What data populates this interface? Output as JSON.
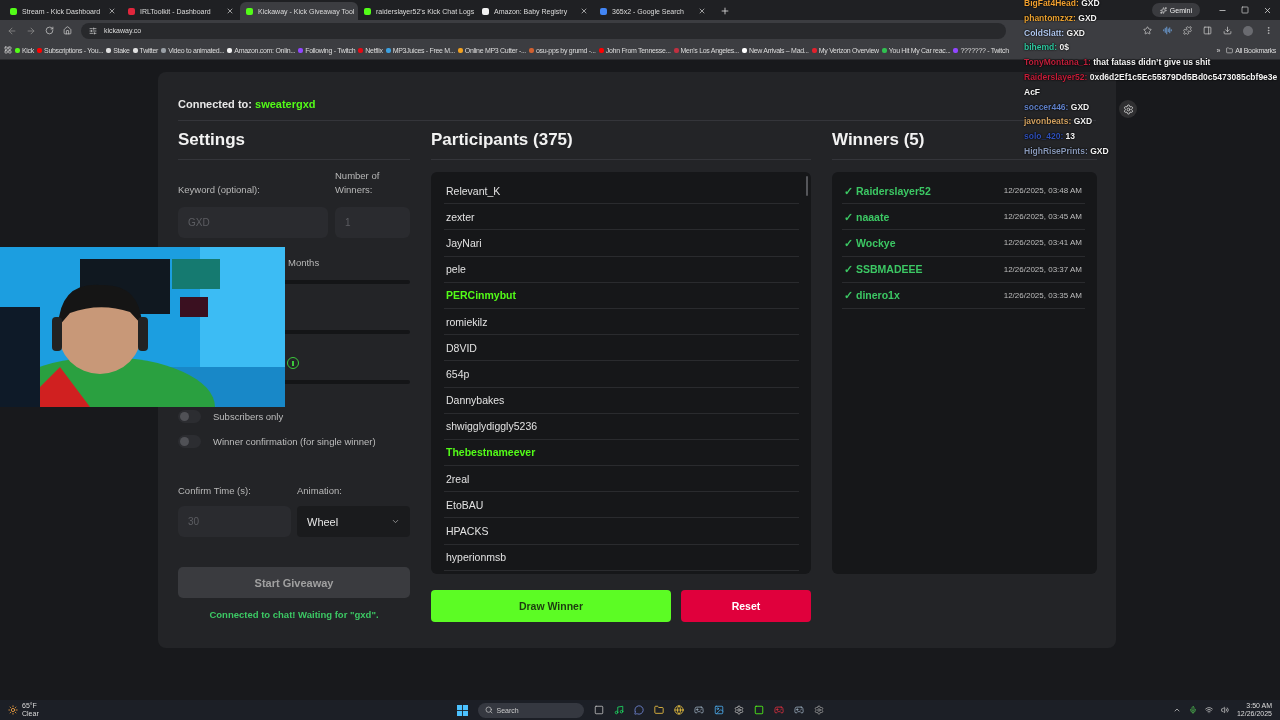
{
  "browser": {
    "tabs": [
      {
        "title": "Stream - Kick Dashboard",
        "selected": false,
        "color": "#53fc18"
      },
      {
        "title": "IRLToolkit - Dashboard",
        "selected": false,
        "color": "#e0263c"
      },
      {
        "title": "Kickaway - Kick Giveaway Tool",
        "selected": true,
        "color": "#53fc18"
      },
      {
        "title": "raiderslayer52's Kick Chat Logs",
        "selected": false,
        "color": "#53fc18"
      },
      {
        "title": "Amazon: Baby Registry",
        "selected": false,
        "color": "#f2f2f2"
      },
      {
        "title": "365x2 - Google Search",
        "selected": false,
        "color": "#4285f4"
      }
    ],
    "gemini": "Gemini",
    "url": "kickaway.co",
    "bookmarks": [
      {
        "label": "Kick",
        "color": "#53fc18"
      },
      {
        "label": "Subscriptions - You...",
        "color": "#ff0000"
      },
      {
        "label": "Stake",
        "color": "#e0e0e0"
      },
      {
        "label": "Twitter",
        "color": "#e0e0e0"
      },
      {
        "label": "Video to animated...",
        "color": "#9aa0a6"
      },
      {
        "label": "Amazon.com: Onlin...",
        "color": "#f2f2f2"
      },
      {
        "label": "Following - Twitch",
        "color": "#9146ff"
      },
      {
        "label": "Netflix",
        "color": "#e50914"
      },
      {
        "label": "MP3Juices - Free M...",
        "color": "#3ca0e0"
      },
      {
        "label": "Online MP3 Cutter -...",
        "color": "#f0a020"
      },
      {
        "label": "osu-pps by grumd -...",
        "color": "#d06030"
      },
      {
        "label": "John From Tennesse...",
        "color": "#ff0000"
      },
      {
        "label": "Men's Los Angeles...",
        "color": "#c03040"
      },
      {
        "label": "New Arrivals – Mad...",
        "color": "#ffffff"
      },
      {
        "label": "My Verizon Overview",
        "color": "#e0202c"
      },
      {
        "label": "You Hit My Car reac...",
        "color": "#30c050"
      },
      {
        "label": "??????? - Twitch",
        "color": "#9146ff"
      }
    ],
    "more": "»",
    "all_bookmarks": "All Bookmarks"
  },
  "page": {
    "connection": {
      "label": "Connected to:",
      "channel": "sweatergxd"
    },
    "settings": {
      "title": "Settings",
      "keyword": {
        "label": "Keyword (optional):",
        "placeholder": "GXD"
      },
      "winner_count": {
        "label": "Number of Winners:",
        "placeholder": "1"
      },
      "months_label": "Months",
      "toggles": [
        {
          "label": "Subscribers only",
          "on": false
        },
        {
          "label": "Winner confirmation (for single winner)",
          "on": false
        }
      ],
      "confirm_time": {
        "label": "Confirm Time (s):",
        "placeholder": "30"
      },
      "animation": {
        "label": "Animation:",
        "value": "Wheel"
      },
      "start_button": {
        "label": "Start Giveaway",
        "disabled": true
      },
      "status": "Connected to chat! Waiting for \"gxd\"."
    },
    "participants": {
      "title": "Participants (375)",
      "items": [
        {
          "name": "Relevant_K",
          "highlighted": false
        },
        {
          "name": "zexter",
          "highlighted": false
        },
        {
          "name": "JayNari",
          "highlighted": false
        },
        {
          "name": "pele",
          "highlighted": false
        },
        {
          "name": "PERCinmybut",
          "highlighted": true
        },
        {
          "name": "romiekilz",
          "highlighted": false
        },
        {
          "name": "D8VID",
          "highlighted": false
        },
        {
          "name": "654p",
          "highlighted": false
        },
        {
          "name": "Dannybakes",
          "highlighted": false
        },
        {
          "name": "shwigglydiggly5236",
          "highlighted": false
        },
        {
          "name": "Thebestnameever",
          "highlighted": true
        },
        {
          "name": "2real",
          "highlighted": false
        },
        {
          "name": "EtoBAU",
          "highlighted": false
        },
        {
          "name": "HPACKS",
          "highlighted": false
        },
        {
          "name": "hyperionmsb",
          "highlighted": false
        }
      ],
      "draw_button": "Draw Winner",
      "reset_button": "Reset"
    },
    "winners": {
      "title": "Winners (5)",
      "items": [
        {
          "mark": "✓",
          "name": "Raiderslayer52",
          "time": "12/26/2025, 03:48 AM"
        },
        {
          "mark": "✓",
          "name": "naaate",
          "time": "12/26/2025, 03:45 AM"
        },
        {
          "mark": "✓",
          "name": "Wockye",
          "time": "12/26/2025, 03:41 AM"
        },
        {
          "mark": "✓",
          "name": "SSBMADEEE",
          "time": "12/26/2025, 03:37 AM"
        },
        {
          "mark": "✓",
          "name": "dinero1x",
          "time": "12/26/2025, 03:35 AM"
        }
      ]
    }
  },
  "chat": [
    {
      "user": "BigFat4Head:",
      "text": "GXD",
      "color": "#f0a030"
    },
    {
      "user": "phantomzxz:",
      "text": "GXD",
      "color": "#e8a030"
    },
    {
      "user": "ColdSlatt:",
      "text": "GXD",
      "color": "#b0c8f0"
    },
    {
      "user": "bihemd:",
      "text": "0$",
      "color": "#30c8a0"
    },
    {
      "user": "TonyMontana_1:",
      "text": "that fatass didn’t give us shit",
      "color": "#c0203c"
    },
    {
      "user": "Raiderslayer52:",
      "text": "0xd6d2Ef1c5Ec55879Dd5Bd0c5473085cbf9e3eAcF",
      "color": "#c41e3a"
    },
    {
      "user": "soccer446:",
      "text": "GXD",
      "color": "#6080c8"
    },
    {
      "user": "javonbeats:",
      "text": "GXD",
      "color": "#d0a060"
    },
    {
      "user": "solo_420:",
      "text": "13",
      "color": "#3050b8"
    },
    {
      "user": "HighRisePrints:",
      "text": "GXD",
      "color": "#8898b8"
    }
  ],
  "taskbar": {
    "temperature": "65°F",
    "condition": "Clear",
    "search": {
      "placeholder": "Search"
    },
    "time": "3:50 AM",
    "date": "12/26/2025"
  }
}
